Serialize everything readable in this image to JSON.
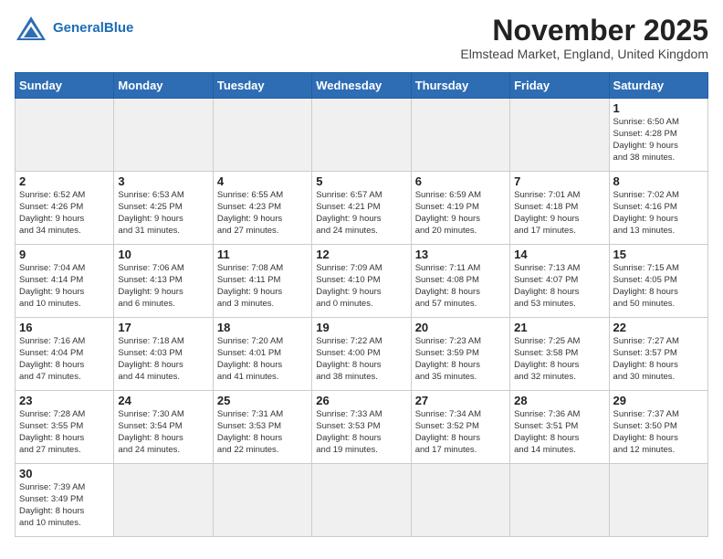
{
  "header": {
    "logo_line1": "General",
    "logo_line2": "Blue",
    "month_title": "November 2025",
    "subtitle": "Elmstead Market, England, United Kingdom"
  },
  "days_of_week": [
    "Sunday",
    "Monday",
    "Tuesday",
    "Wednesday",
    "Thursday",
    "Friday",
    "Saturday"
  ],
  "weeks": [
    [
      {
        "day": "",
        "info": "",
        "empty": true
      },
      {
        "day": "",
        "info": "",
        "empty": true
      },
      {
        "day": "",
        "info": "",
        "empty": true
      },
      {
        "day": "",
        "info": "",
        "empty": true
      },
      {
        "day": "",
        "info": "",
        "empty": true
      },
      {
        "day": "",
        "info": "",
        "empty": true
      },
      {
        "day": "1",
        "info": "Sunrise: 6:50 AM\nSunset: 4:28 PM\nDaylight: 9 hours\nand 38 minutes."
      }
    ],
    [
      {
        "day": "2",
        "info": "Sunrise: 6:52 AM\nSunset: 4:26 PM\nDaylight: 9 hours\nand 34 minutes."
      },
      {
        "day": "3",
        "info": "Sunrise: 6:53 AM\nSunset: 4:25 PM\nDaylight: 9 hours\nand 31 minutes."
      },
      {
        "day": "4",
        "info": "Sunrise: 6:55 AM\nSunset: 4:23 PM\nDaylight: 9 hours\nand 27 minutes."
      },
      {
        "day": "5",
        "info": "Sunrise: 6:57 AM\nSunset: 4:21 PM\nDaylight: 9 hours\nand 24 minutes."
      },
      {
        "day": "6",
        "info": "Sunrise: 6:59 AM\nSunset: 4:19 PM\nDaylight: 9 hours\nand 20 minutes."
      },
      {
        "day": "7",
        "info": "Sunrise: 7:01 AM\nSunset: 4:18 PM\nDaylight: 9 hours\nand 17 minutes."
      },
      {
        "day": "8",
        "info": "Sunrise: 7:02 AM\nSunset: 4:16 PM\nDaylight: 9 hours\nand 13 minutes."
      }
    ],
    [
      {
        "day": "9",
        "info": "Sunrise: 7:04 AM\nSunset: 4:14 PM\nDaylight: 9 hours\nand 10 minutes."
      },
      {
        "day": "10",
        "info": "Sunrise: 7:06 AM\nSunset: 4:13 PM\nDaylight: 9 hours\nand 6 minutes."
      },
      {
        "day": "11",
        "info": "Sunrise: 7:08 AM\nSunset: 4:11 PM\nDaylight: 9 hours\nand 3 minutes."
      },
      {
        "day": "12",
        "info": "Sunrise: 7:09 AM\nSunset: 4:10 PM\nDaylight: 9 hours\nand 0 minutes."
      },
      {
        "day": "13",
        "info": "Sunrise: 7:11 AM\nSunset: 4:08 PM\nDaylight: 8 hours\nand 57 minutes."
      },
      {
        "day": "14",
        "info": "Sunrise: 7:13 AM\nSunset: 4:07 PM\nDaylight: 8 hours\nand 53 minutes."
      },
      {
        "day": "15",
        "info": "Sunrise: 7:15 AM\nSunset: 4:05 PM\nDaylight: 8 hours\nand 50 minutes."
      }
    ],
    [
      {
        "day": "16",
        "info": "Sunrise: 7:16 AM\nSunset: 4:04 PM\nDaylight: 8 hours\nand 47 minutes."
      },
      {
        "day": "17",
        "info": "Sunrise: 7:18 AM\nSunset: 4:03 PM\nDaylight: 8 hours\nand 44 minutes."
      },
      {
        "day": "18",
        "info": "Sunrise: 7:20 AM\nSunset: 4:01 PM\nDaylight: 8 hours\nand 41 minutes."
      },
      {
        "day": "19",
        "info": "Sunrise: 7:22 AM\nSunset: 4:00 PM\nDaylight: 8 hours\nand 38 minutes."
      },
      {
        "day": "20",
        "info": "Sunrise: 7:23 AM\nSunset: 3:59 PM\nDaylight: 8 hours\nand 35 minutes."
      },
      {
        "day": "21",
        "info": "Sunrise: 7:25 AM\nSunset: 3:58 PM\nDaylight: 8 hours\nand 32 minutes."
      },
      {
        "day": "22",
        "info": "Sunrise: 7:27 AM\nSunset: 3:57 PM\nDaylight: 8 hours\nand 30 minutes."
      }
    ],
    [
      {
        "day": "23",
        "info": "Sunrise: 7:28 AM\nSunset: 3:55 PM\nDaylight: 8 hours\nand 27 minutes."
      },
      {
        "day": "24",
        "info": "Sunrise: 7:30 AM\nSunset: 3:54 PM\nDaylight: 8 hours\nand 24 minutes."
      },
      {
        "day": "25",
        "info": "Sunrise: 7:31 AM\nSunset: 3:53 PM\nDaylight: 8 hours\nand 22 minutes."
      },
      {
        "day": "26",
        "info": "Sunrise: 7:33 AM\nSunset: 3:53 PM\nDaylight: 8 hours\nand 19 minutes."
      },
      {
        "day": "27",
        "info": "Sunrise: 7:34 AM\nSunset: 3:52 PM\nDaylight: 8 hours\nand 17 minutes."
      },
      {
        "day": "28",
        "info": "Sunrise: 7:36 AM\nSunset: 3:51 PM\nDaylight: 8 hours\nand 14 minutes."
      },
      {
        "day": "29",
        "info": "Sunrise: 7:37 AM\nSunset: 3:50 PM\nDaylight: 8 hours\nand 12 minutes."
      }
    ],
    [
      {
        "day": "30",
        "info": "Sunrise: 7:39 AM\nSunset: 3:49 PM\nDaylight: 8 hours\nand 10 minutes."
      },
      {
        "day": "",
        "info": "",
        "empty": true
      },
      {
        "day": "",
        "info": "",
        "empty": true
      },
      {
        "day": "",
        "info": "",
        "empty": true
      },
      {
        "day": "",
        "info": "",
        "empty": true
      },
      {
        "day": "",
        "info": "",
        "empty": true
      },
      {
        "day": "",
        "info": "",
        "empty": true
      }
    ]
  ]
}
